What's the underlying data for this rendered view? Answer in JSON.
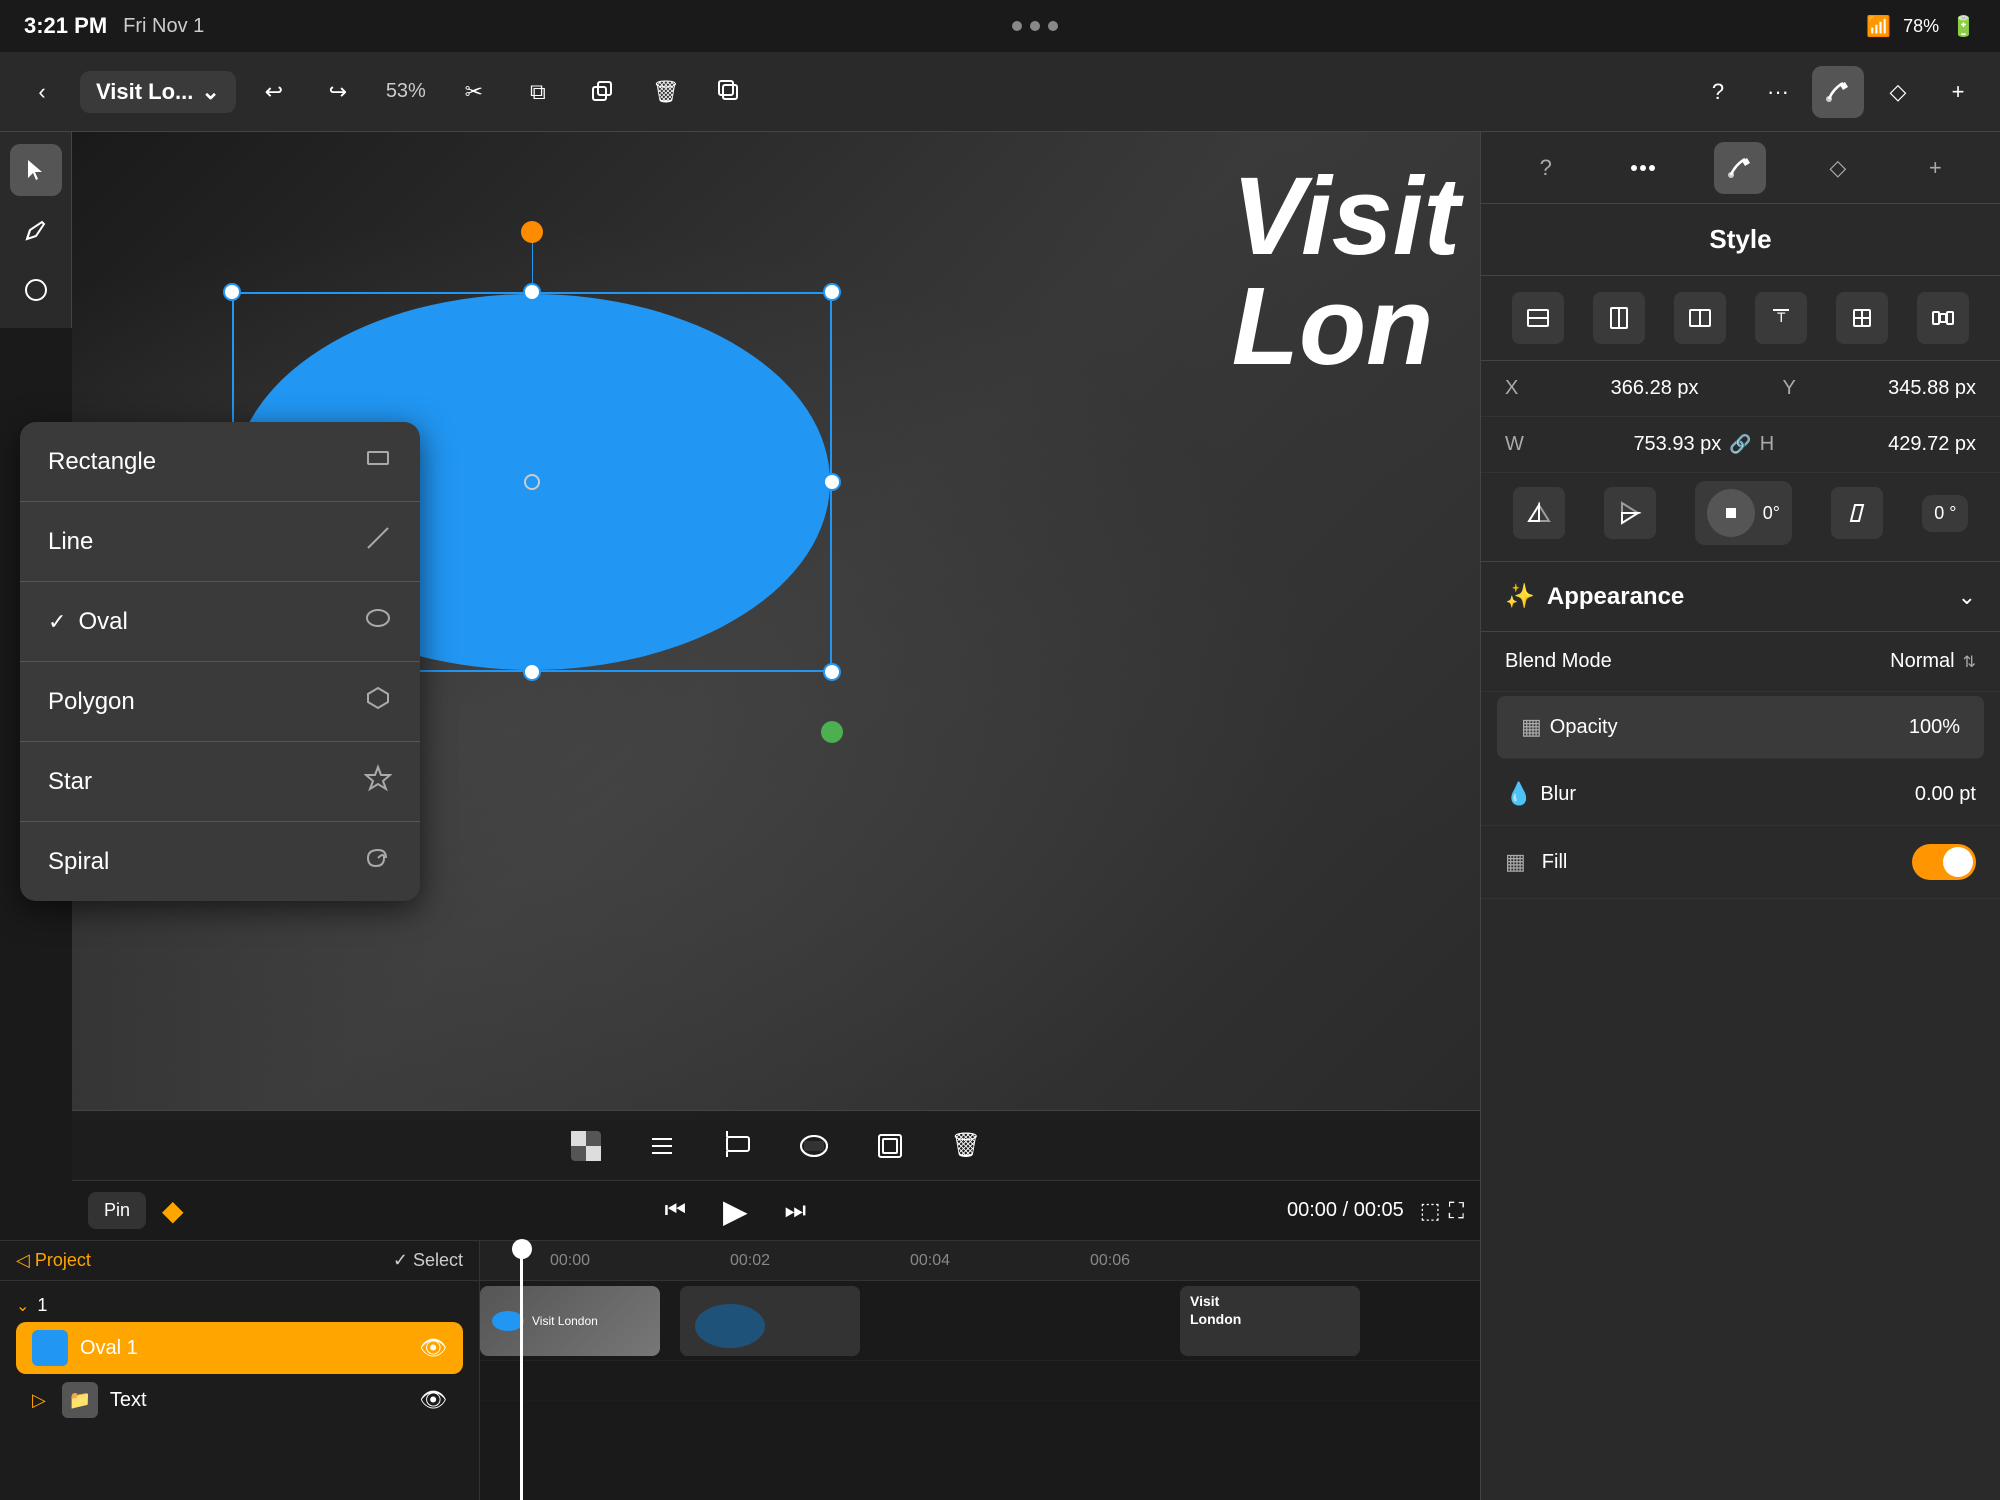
{
  "statusBar": {
    "time": "3:21 PM",
    "date": "Fri Nov 1",
    "wifi": "WiFi",
    "battery": "78%"
  },
  "toolbar": {
    "back_label": "‹",
    "project_title": "Visit Lo...",
    "chevron": "⌄",
    "undo_label": "↩",
    "redo_label": "↪",
    "zoom_label": "53%",
    "cut_label": "✂",
    "copy_label": "⧉",
    "paste_label": "⬚",
    "delete_label": "🗑",
    "duplicate_label": "⧉",
    "help_label": "?",
    "more_label": "···",
    "brush_label": "✏",
    "diamond_label": "◇",
    "add_label": "+"
  },
  "tools": {
    "select_label": "▲",
    "pen_label": "✒",
    "shape_label": "○"
  },
  "shapeMenu": {
    "items": [
      {
        "id": "rectangle",
        "label": "Rectangle",
        "icon": "▭",
        "selected": false
      },
      {
        "id": "line",
        "label": "Line",
        "icon": "/",
        "selected": false
      },
      {
        "id": "oval",
        "label": "Oval",
        "icon": "○",
        "selected": true
      },
      {
        "id": "polygon",
        "label": "Polygon",
        "icon": "⬡",
        "selected": false
      },
      {
        "id": "star",
        "label": "Star",
        "icon": "☆",
        "selected": false
      },
      {
        "id": "spiral",
        "label": "Spiral",
        "icon": "◉",
        "selected": false
      }
    ]
  },
  "canvas": {
    "title_line1": "Visit",
    "title_line2": "Lon"
  },
  "bottomBar": {
    "pin_label": "Pin",
    "time_current": "00:00",
    "time_total": "00:05",
    "rewind_label": "⏮",
    "play_label": "▶",
    "forward_label": "⏭"
  },
  "timeline": {
    "marks": [
      "00:00",
      "00:02",
      "00:04",
      "00:06"
    ]
  },
  "layers": {
    "project_label": "◁ Project",
    "select_label": "✓ Select",
    "group1": {
      "label": "1",
      "items": [
        {
          "id": "oval1",
          "name": "Oval 1",
          "visible": true,
          "type": "oval",
          "active": true
        },
        {
          "id": "text",
          "name": "Text",
          "visible": true,
          "type": "folder",
          "active": false
        }
      ]
    }
  },
  "rightPanel": {
    "tabs": [
      {
        "id": "help",
        "icon": "?",
        "active": false
      },
      {
        "id": "more",
        "icon": "···",
        "active": false
      },
      {
        "id": "brush",
        "icon": "✏",
        "active": true
      },
      {
        "id": "diamond",
        "icon": "◇",
        "active": false
      },
      {
        "id": "add",
        "icon": "+",
        "active": false
      }
    ],
    "style_title": "Style",
    "alignButtons": [
      "⊞",
      "⊟",
      "⊠",
      "T↕",
      "⊞",
      "📊"
    ],
    "properties": {
      "x_label": "X",
      "x_value": "366.28 px",
      "y_label": "Y",
      "y_value": "345.88 px",
      "w_label": "W",
      "w_value": "753.93 px",
      "h_label": "H",
      "h_value": "429.72 px"
    },
    "rotateControls": {
      "rotation_value": "0°",
      "skew_value": "0 °"
    },
    "appearance": {
      "title": "Appearance",
      "blend_mode_label": "Blend Mode",
      "blend_mode_value": "Normal",
      "opacity_label": "Opacity",
      "opacity_value": "100%",
      "blur_label": "Blur",
      "blur_value": "0.00 pt",
      "fill_label": "Fill"
    }
  }
}
